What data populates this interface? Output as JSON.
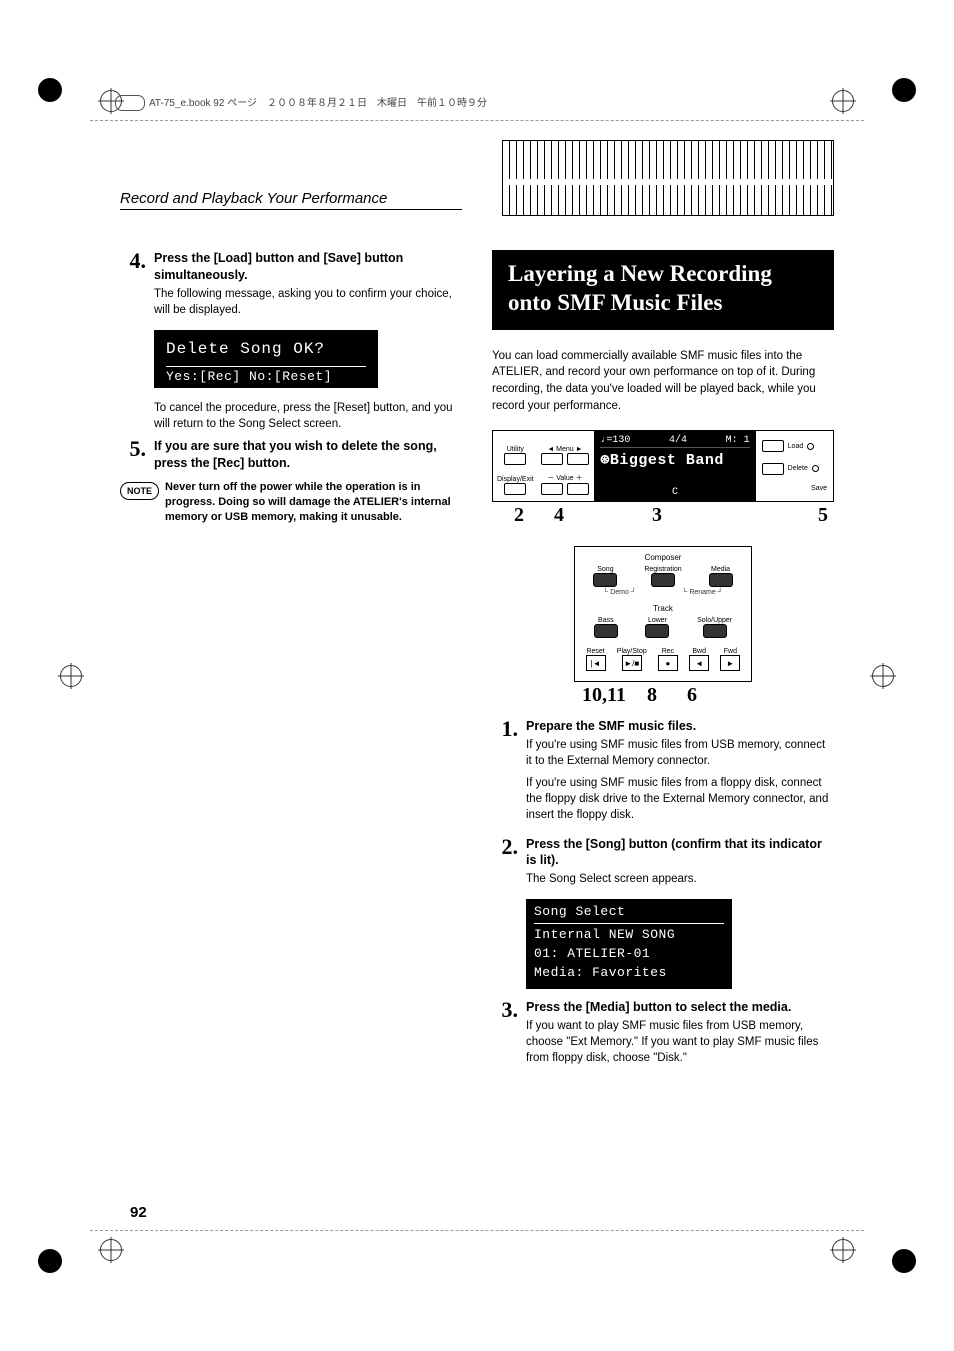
{
  "header_note": "AT-75_e.book 92 ページ　２００８年８月２１日　木曜日　午前１０時９分",
  "section_title": "Record and Playback Your Performance",
  "page_number": "92",
  "left": {
    "step4": {
      "num": "4.",
      "head": "Press the [Load] button and [Save] button simultaneously.",
      "desc": "The following message, asking you to confirm your choice, will be displayed."
    },
    "lcd": {
      "line1": "Delete Song OK?",
      "line2": "Yes:[Rec] No:[Reset]"
    },
    "after_lcd": "To cancel the procedure, press the [Reset] button, and you will return to the Song Select screen.",
    "step5": {
      "num": "5.",
      "head": "If you are sure that you wish to delete the song, press the [Rec] button."
    },
    "note": {
      "label": "NOTE",
      "text": "Never turn off the power while the operation is in progress. Doing so will damage the ATELIER's internal memory or USB memory, making it unusable."
    }
  },
  "right": {
    "heading": "Layering a New Recording onto SMF Music Files",
    "intro": "You can load commercially available SMF music files into the ATELIER, and record your own performance on top of it. During recording, the data you've loaded will be played back, while you record your performance.",
    "lcd_top": {
      "tempo": "♩=130",
      "time": "4/4",
      "meas": "M:   1",
      "title": "Biggest Band",
      "c": "C"
    },
    "btn_labels": {
      "utility": "Utility",
      "menu": "◄ Menu ►",
      "display": "Display/Exit",
      "value": "－ Value ＋",
      "load": "Load",
      "delete": "Delete",
      "save": "Save"
    },
    "callouts_top": {
      "a": "2",
      "b": "4",
      "c": "3",
      "d": "5"
    },
    "composer": {
      "title": "Composer",
      "row1": [
        "Song",
        "Registration",
        "Media"
      ],
      "sub1": [
        "Demo",
        "Rename"
      ],
      "track_title": "Track",
      "row2": [
        "Bass",
        "Lower",
        "Solo/Upper"
      ],
      "transport": [
        "Reset",
        "Play/Stop",
        "Rec",
        "Bwd",
        "Fwd"
      ],
      "transport_sym": [
        "|◄",
        "►/■",
        "●",
        "◄",
        "►"
      ]
    },
    "callouts_bot": {
      "a": "10,11",
      "b": "8",
      "c": "6"
    },
    "step1": {
      "num": "1.",
      "head": "Prepare the SMF music files.",
      "desc1": "If you're using SMF music files from USB memory, connect it to the External Memory connector.",
      "desc2": "If you're using SMF music files from a floppy disk, connect the floppy disk drive to the External Memory connector, and insert the floppy disk."
    },
    "step2": {
      "num": "2.",
      "head": "Press the [Song] button (confirm that its indicator is lit).",
      "desc": "The Song Select screen appears."
    },
    "lcd2": {
      "title": "Song Select",
      "l1": "Internal NEW SONG",
      "l2": "   01: ATELIER-01",
      "l3": "Media: Favorites"
    },
    "step3": {
      "num": "3.",
      "head": "Press the [Media] button to select the media.",
      "desc": "If you want to play SMF music files from USB memory, choose \"Ext Memory.\" If you want to play SMF music files from floppy disk, choose \"Disk.\""
    }
  }
}
